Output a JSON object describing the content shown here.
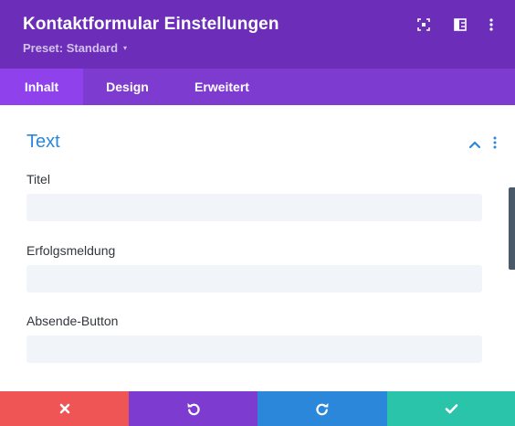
{
  "header": {
    "title": "Kontaktformular Einstellungen",
    "preset_label": "Preset: Standard",
    "icons": [
      "expand-icon",
      "split-view-icon",
      "more-vertical-icon"
    ]
  },
  "tabs": [
    {
      "label": "Inhalt",
      "active": true
    },
    {
      "label": "Design",
      "active": false
    },
    {
      "label": "Erweitert",
      "active": false
    }
  ],
  "section": {
    "title": "Text",
    "fields": [
      {
        "label": "Titel",
        "value": ""
      },
      {
        "label": "Erfolgsmeldung",
        "value": ""
      },
      {
        "label": "Absende-Button",
        "value": ""
      }
    ]
  },
  "footer": {
    "buttons": [
      "cancel-icon",
      "undo-icon",
      "redo-icon",
      "save-check-icon"
    ]
  },
  "colors": {
    "header_bg": "#6c2eb9",
    "tabs_bg": "#7e3bd0",
    "tab_active_bg": "#8f42ec",
    "accent_blue": "#2b87da",
    "cancel": "#ef5555",
    "undo": "#7e3bd0",
    "redo": "#2b87da",
    "save": "#29c4a9"
  }
}
